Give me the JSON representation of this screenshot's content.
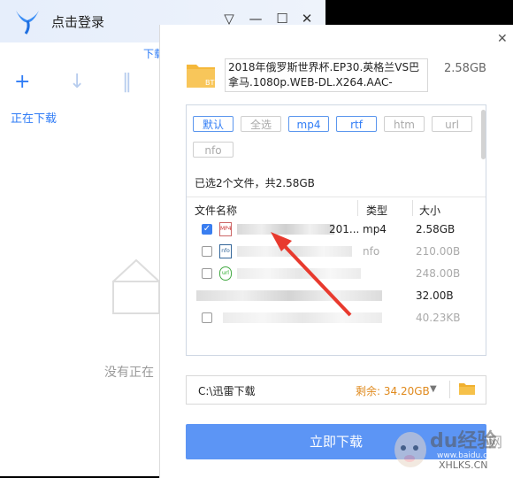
{
  "main": {
    "login_label": "点击登录",
    "download_tab": "下载",
    "downloading_label": "正在下载",
    "empty_text": "没有正在"
  },
  "dialog": {
    "file_title": "2018年俄罗斯世界杯.EP30.英格兰VS巴拿马.1080p.WEB-DL.X264.AAC-",
    "total_size": "2.58GB",
    "filters": [
      "默认",
      "全选",
      "mp4",
      "rtf",
      "htm",
      "url",
      "nfo"
    ],
    "selected_info": "已选2个文件，共2.58GB",
    "columns": {
      "name": "文件名称",
      "type": "类型",
      "size": "大小"
    },
    "rows": [
      {
        "name_tail": "201...",
        "type": "mp4",
        "size": "2.58GB",
        "checked": true,
        "icon": "MP4"
      },
      {
        "name_tail": "",
        "type": "nfo",
        "size": "210.00B",
        "checked": false,
        "icon": "nfo"
      },
      {
        "name_tail": "",
        "type": "",
        "size": "248.00B",
        "checked": false,
        "icon": "url"
      },
      {
        "name_tail": "",
        "type": "",
        "size": "32.00B",
        "checked": false,
        "icon": ""
      },
      {
        "name_tail": "",
        "type": "",
        "size": "40.23KB",
        "checked": false,
        "icon": ""
      }
    ],
    "save_path": "C:\\迅雷下载",
    "free_space": "剩余: 34.20GB",
    "download_now": "立即下载"
  },
  "watermark": {
    "text": "du经验",
    "site": "www.baidu.com",
    "xh": "XHLKS.CN",
    "net": "网"
  },
  "colors": {
    "accent": "#2f7cf6",
    "button": "#5c95f5",
    "warn": "#e08a1e"
  }
}
